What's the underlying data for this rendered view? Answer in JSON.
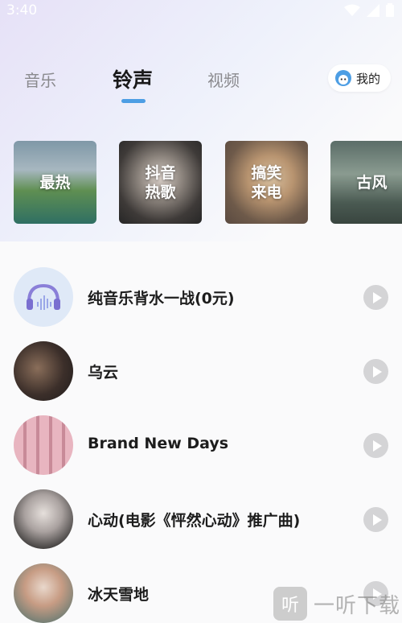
{
  "status_bar": {
    "time": "3:40",
    "icons": [
      "wifi-icon",
      "signal-icon",
      "battery-icon"
    ]
  },
  "tabs": [
    {
      "label": "音乐",
      "active": false
    },
    {
      "label": "铃声",
      "active": true
    },
    {
      "label": "视频",
      "active": false
    }
  ],
  "mine_button": {
    "label": "我的",
    "icon": "avatar-icon"
  },
  "categories": [
    {
      "label": "最热"
    },
    {
      "label": "抖音\n热歌"
    },
    {
      "label": "搞笑\n来电"
    },
    {
      "label": "古风"
    }
  ],
  "songs": [
    {
      "title": "纯音乐背水一战(0元)"
    },
    {
      "title": "乌云"
    },
    {
      "title": "Brand New Days"
    },
    {
      "title": "心动(电影《怦然心动》推广曲)"
    },
    {
      "title": "冰天雪地"
    }
  ],
  "watermark": {
    "logo": "听",
    "text": "一听下载"
  },
  "colors": {
    "accent": "#4d9ee4",
    "play_button": "#d4d4d6",
    "title_text": "#1d1d1d",
    "inactive_tab": "#8a8a8e"
  }
}
